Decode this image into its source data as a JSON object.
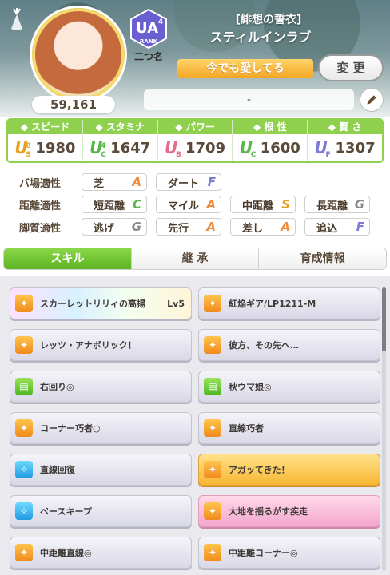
{
  "profile": {
    "fan_count": "59,161",
    "rank_label": "RANK",
    "rank_grade": "UA",
    "rank_sub": "4",
    "nickname": "二つ名",
    "epithet": "[緋想の誓衣]",
    "name": "スティルインラブ",
    "title_plate": "今でも愛してる",
    "change_button": "変 更",
    "comment": "-"
  },
  "stats": [
    {
      "label": "スピード",
      "icon": "shoe-icon",
      "grade": "U",
      "sub_a": "8",
      "sub_b": "S",
      "value": "1980"
    },
    {
      "label": "スタミナ",
      "icon": "heart-icon",
      "grade": "U",
      "sub_a": "4",
      "sub_b": "C",
      "value": "1647"
    },
    {
      "label": "パワー",
      "icon": "arm-icon",
      "grade": "U",
      "sub_a": "",
      "sub_b": "B",
      "value": "1709"
    },
    {
      "label": "根 性",
      "icon": "flame-icon",
      "grade": "U",
      "sub_a": "",
      "sub_b": "C",
      "value": "1600"
    },
    {
      "label": "賢 さ",
      "icon": "graduation-cap-icon",
      "grade": "U",
      "sub_a": "",
      "sub_b": "F",
      "value": "1307"
    }
  ],
  "aptitude": {
    "track_label": "バ場適性",
    "distance_label": "距離適性",
    "style_label": "脚質適性",
    "track": [
      {
        "name": "芝",
        "grade": "A"
      },
      {
        "name": "ダート",
        "grade": "F"
      }
    ],
    "distance": [
      {
        "name": "短距離",
        "grade": "C"
      },
      {
        "name": "マイル",
        "grade": "A"
      },
      {
        "name": "中距離",
        "grade": "S"
      },
      {
        "name": "長距離",
        "grade": "G"
      }
    ],
    "style": [
      {
        "name": "逃げ",
        "grade": "G"
      },
      {
        "name": "先行",
        "grade": "A"
      },
      {
        "name": "差し",
        "grade": "A"
      },
      {
        "name": "追込",
        "grade": "F"
      }
    ]
  },
  "grade_colors": {
    "S": "#e8a020",
    "A": "#f08a3c",
    "B": "#e66a8a",
    "C": "#56b84a",
    "D": "#5aa0e0",
    "E": "#b06ad0",
    "F": "#7d7ad8",
    "G": "#8a8a8a"
  },
  "tabs": [
    "スキル",
    "継 承",
    "育成情報"
  ],
  "skills": [
    {
      "name": "スカーレットリリィの高揚",
      "level": "Lv5",
      "style": "rainbow",
      "icon": "orange"
    },
    {
      "name": "紅焔ギア/LP1211-M",
      "level": "",
      "style": "normal",
      "icon": "orange"
    },
    {
      "name": "レッツ・アナボリック！",
      "level": "",
      "style": "normal",
      "icon": "orange"
    },
    {
      "name": "彼方、その先へ…",
      "level": "",
      "style": "normal",
      "icon": "orange"
    },
    {
      "name": "右回り◎",
      "level": "",
      "style": "normal",
      "icon": "green"
    },
    {
      "name": "秋ウマ娘◎",
      "level": "",
      "style": "normal",
      "icon": "green"
    },
    {
      "name": "コーナー巧者○",
      "level": "",
      "style": "normal",
      "icon": "orange"
    },
    {
      "name": "直線巧者",
      "level": "",
      "style": "normal",
      "icon": "orange"
    },
    {
      "name": "直線回復",
      "level": "",
      "style": "normal",
      "icon": "blue"
    },
    {
      "name": "アガッてきた！",
      "level": "",
      "style": "gold",
      "icon": "orange"
    },
    {
      "name": "ペースキープ",
      "level": "",
      "style": "normal",
      "icon": "blue"
    },
    {
      "name": "大地を揺るがす疾走",
      "level": "",
      "style": "pink",
      "icon": "orange"
    },
    {
      "name": "中距離直線◎",
      "level": "",
      "style": "normal",
      "icon": "orange"
    },
    {
      "name": "中距離コーナー◎",
      "level": "",
      "style": "normal",
      "icon": "orange"
    }
  ]
}
